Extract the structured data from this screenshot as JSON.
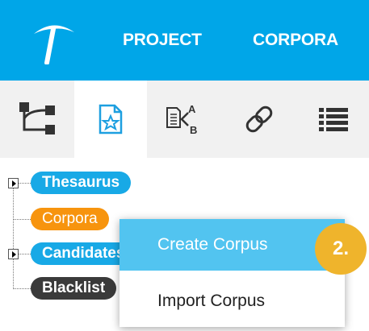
{
  "header": {
    "logo_icon": "pickaxe-logo-icon",
    "nav": [
      {
        "label": "PROJECT"
      },
      {
        "label": "CORPORA"
      }
    ],
    "background": "#00a6e8"
  },
  "toolbar": {
    "tools": [
      {
        "icon": "tree-structure-icon"
      },
      {
        "icon": "star-document-icon",
        "active": true
      },
      {
        "icon": "document-compare-icon"
      },
      {
        "icon": "link-icon"
      },
      {
        "icon": "list-icon"
      }
    ]
  },
  "tree": {
    "nodes": [
      {
        "label": "Thesaurus",
        "color": "#18a9e6",
        "expandable": true
      },
      {
        "label": "Corpora",
        "color": "#f7940e",
        "expandable": false
      },
      {
        "label": "Candidates",
        "color": "#18a9e6",
        "expandable": true
      },
      {
        "label": "Blacklist",
        "color": "#3a3a3a",
        "expandable": false
      }
    ]
  },
  "context_menu": {
    "items": [
      {
        "label": "Create Corpus",
        "highlighted": true
      },
      {
        "label": "Import Corpus",
        "highlighted": false
      }
    ]
  },
  "step_badge": {
    "label": "2."
  }
}
